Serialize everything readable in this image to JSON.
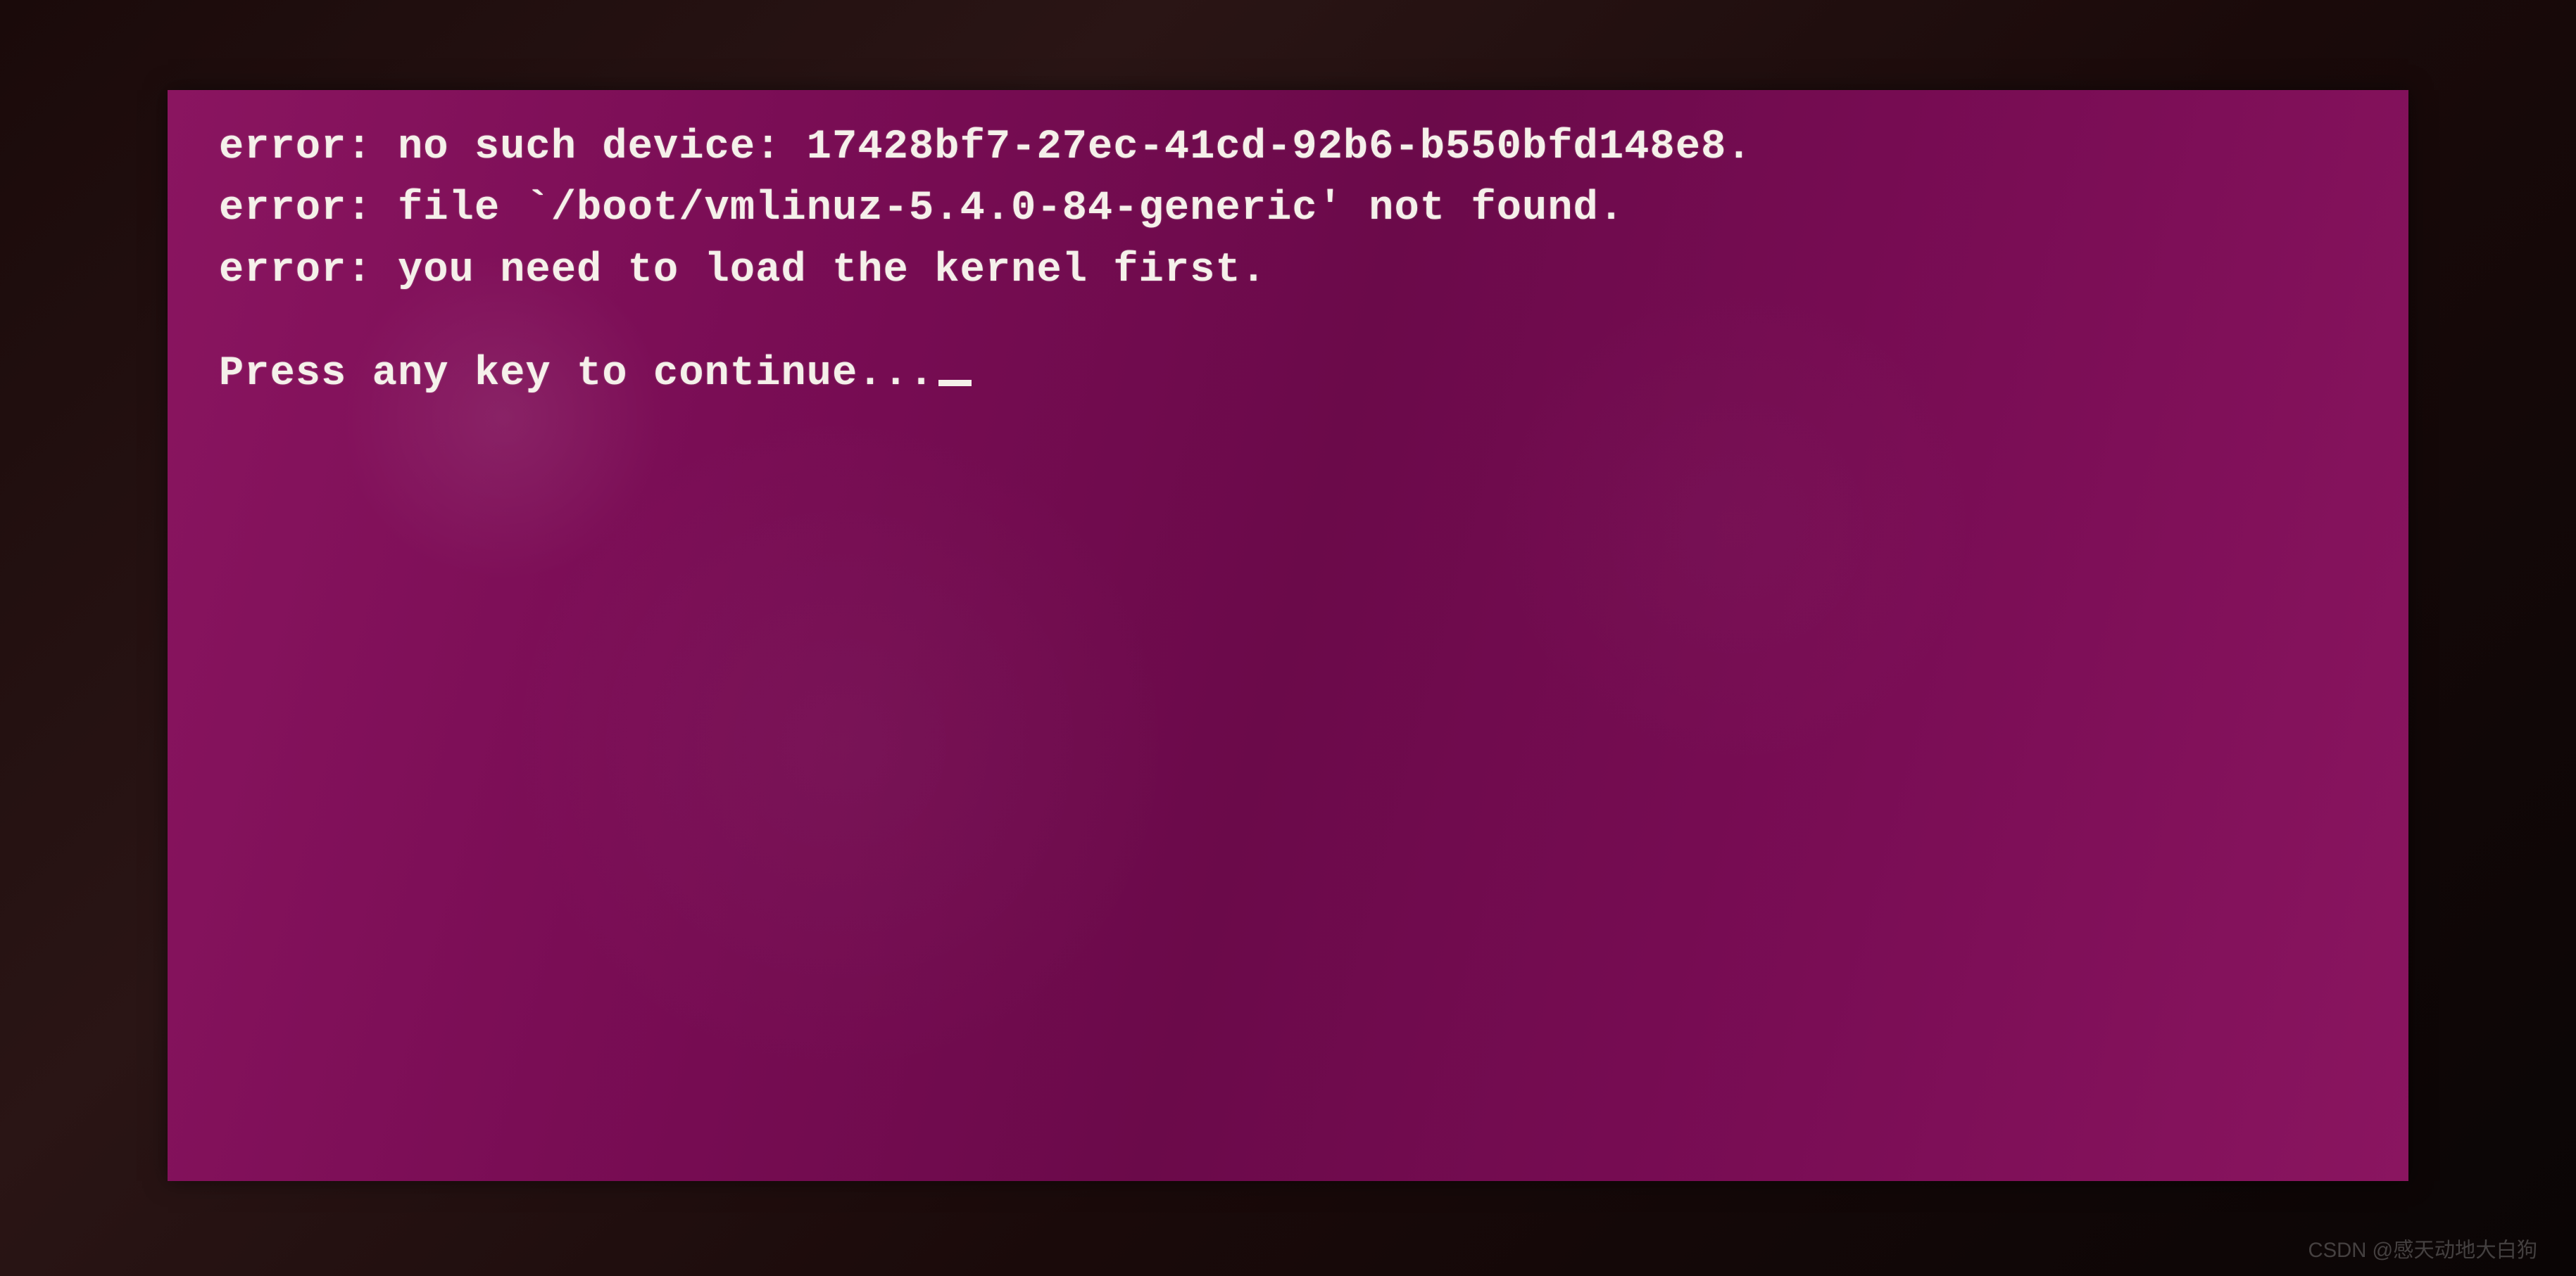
{
  "terminal": {
    "lines": [
      "error: no such device: 17428bf7-27ec-41cd-92b6-b550bfd148e8.",
      "error: file `/boot/vmlinuz-5.4.0-84-generic' not found.",
      "error: you need to load the kernel first."
    ],
    "prompt": "Press any key to continue..."
  },
  "watermark": "CSDN @感天动地大白狗",
  "colors": {
    "background": "#7a0d55",
    "text": "#f5f0ea",
    "frame": "#1a0a0a"
  }
}
